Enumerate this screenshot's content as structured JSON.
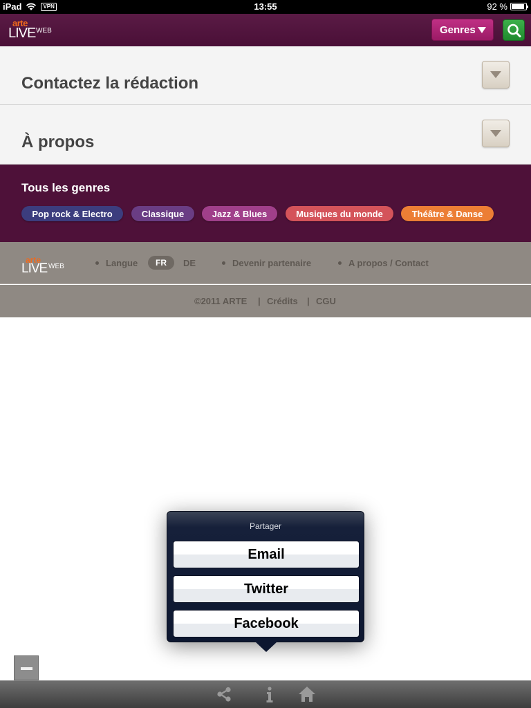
{
  "status_bar": {
    "device": "iPad",
    "vpn": "VPN",
    "time": "13:55",
    "battery": "92 %"
  },
  "header": {
    "logo_arte": "arte",
    "logo_live": "LIVE",
    "logo_web": "WEB",
    "genres_button": "Genres",
    "search_icon": "search-icon"
  },
  "sections": [
    {
      "title": "Contactez la rédaction"
    },
    {
      "title": "À propos"
    }
  ],
  "genres": {
    "heading": "Tous les genres",
    "pills": [
      {
        "label": "Pop rock & Electro",
        "color": "#3c3d7e"
      },
      {
        "label": "Classique",
        "color": "#6a3d84"
      },
      {
        "label": "Jazz & Blues",
        "color": "#a03f8a"
      },
      {
        "label": "Musiques du monde",
        "color": "#d4535a"
      },
      {
        "label": "Théâtre & Danse",
        "color": "#ec7e35"
      }
    ]
  },
  "footer": {
    "logo_arte": "arte",
    "logo_live": "LIVE",
    "logo_web": "WEB",
    "langue_label": "Langue",
    "lang_fr": "FR",
    "lang_de": "DE",
    "partner_link": "Devenir partenaire",
    "about_link": "A propos / Contact",
    "copyright": "©2011 ARTE",
    "credits_link": "Crédits",
    "cgu_link": "CGU"
  },
  "share_popover": {
    "title": "Partager",
    "options": [
      "Email",
      "Twitter",
      "Facebook"
    ]
  },
  "toolbar": {
    "icons": [
      "share-icon",
      "info-icon",
      "home-icon"
    ]
  }
}
